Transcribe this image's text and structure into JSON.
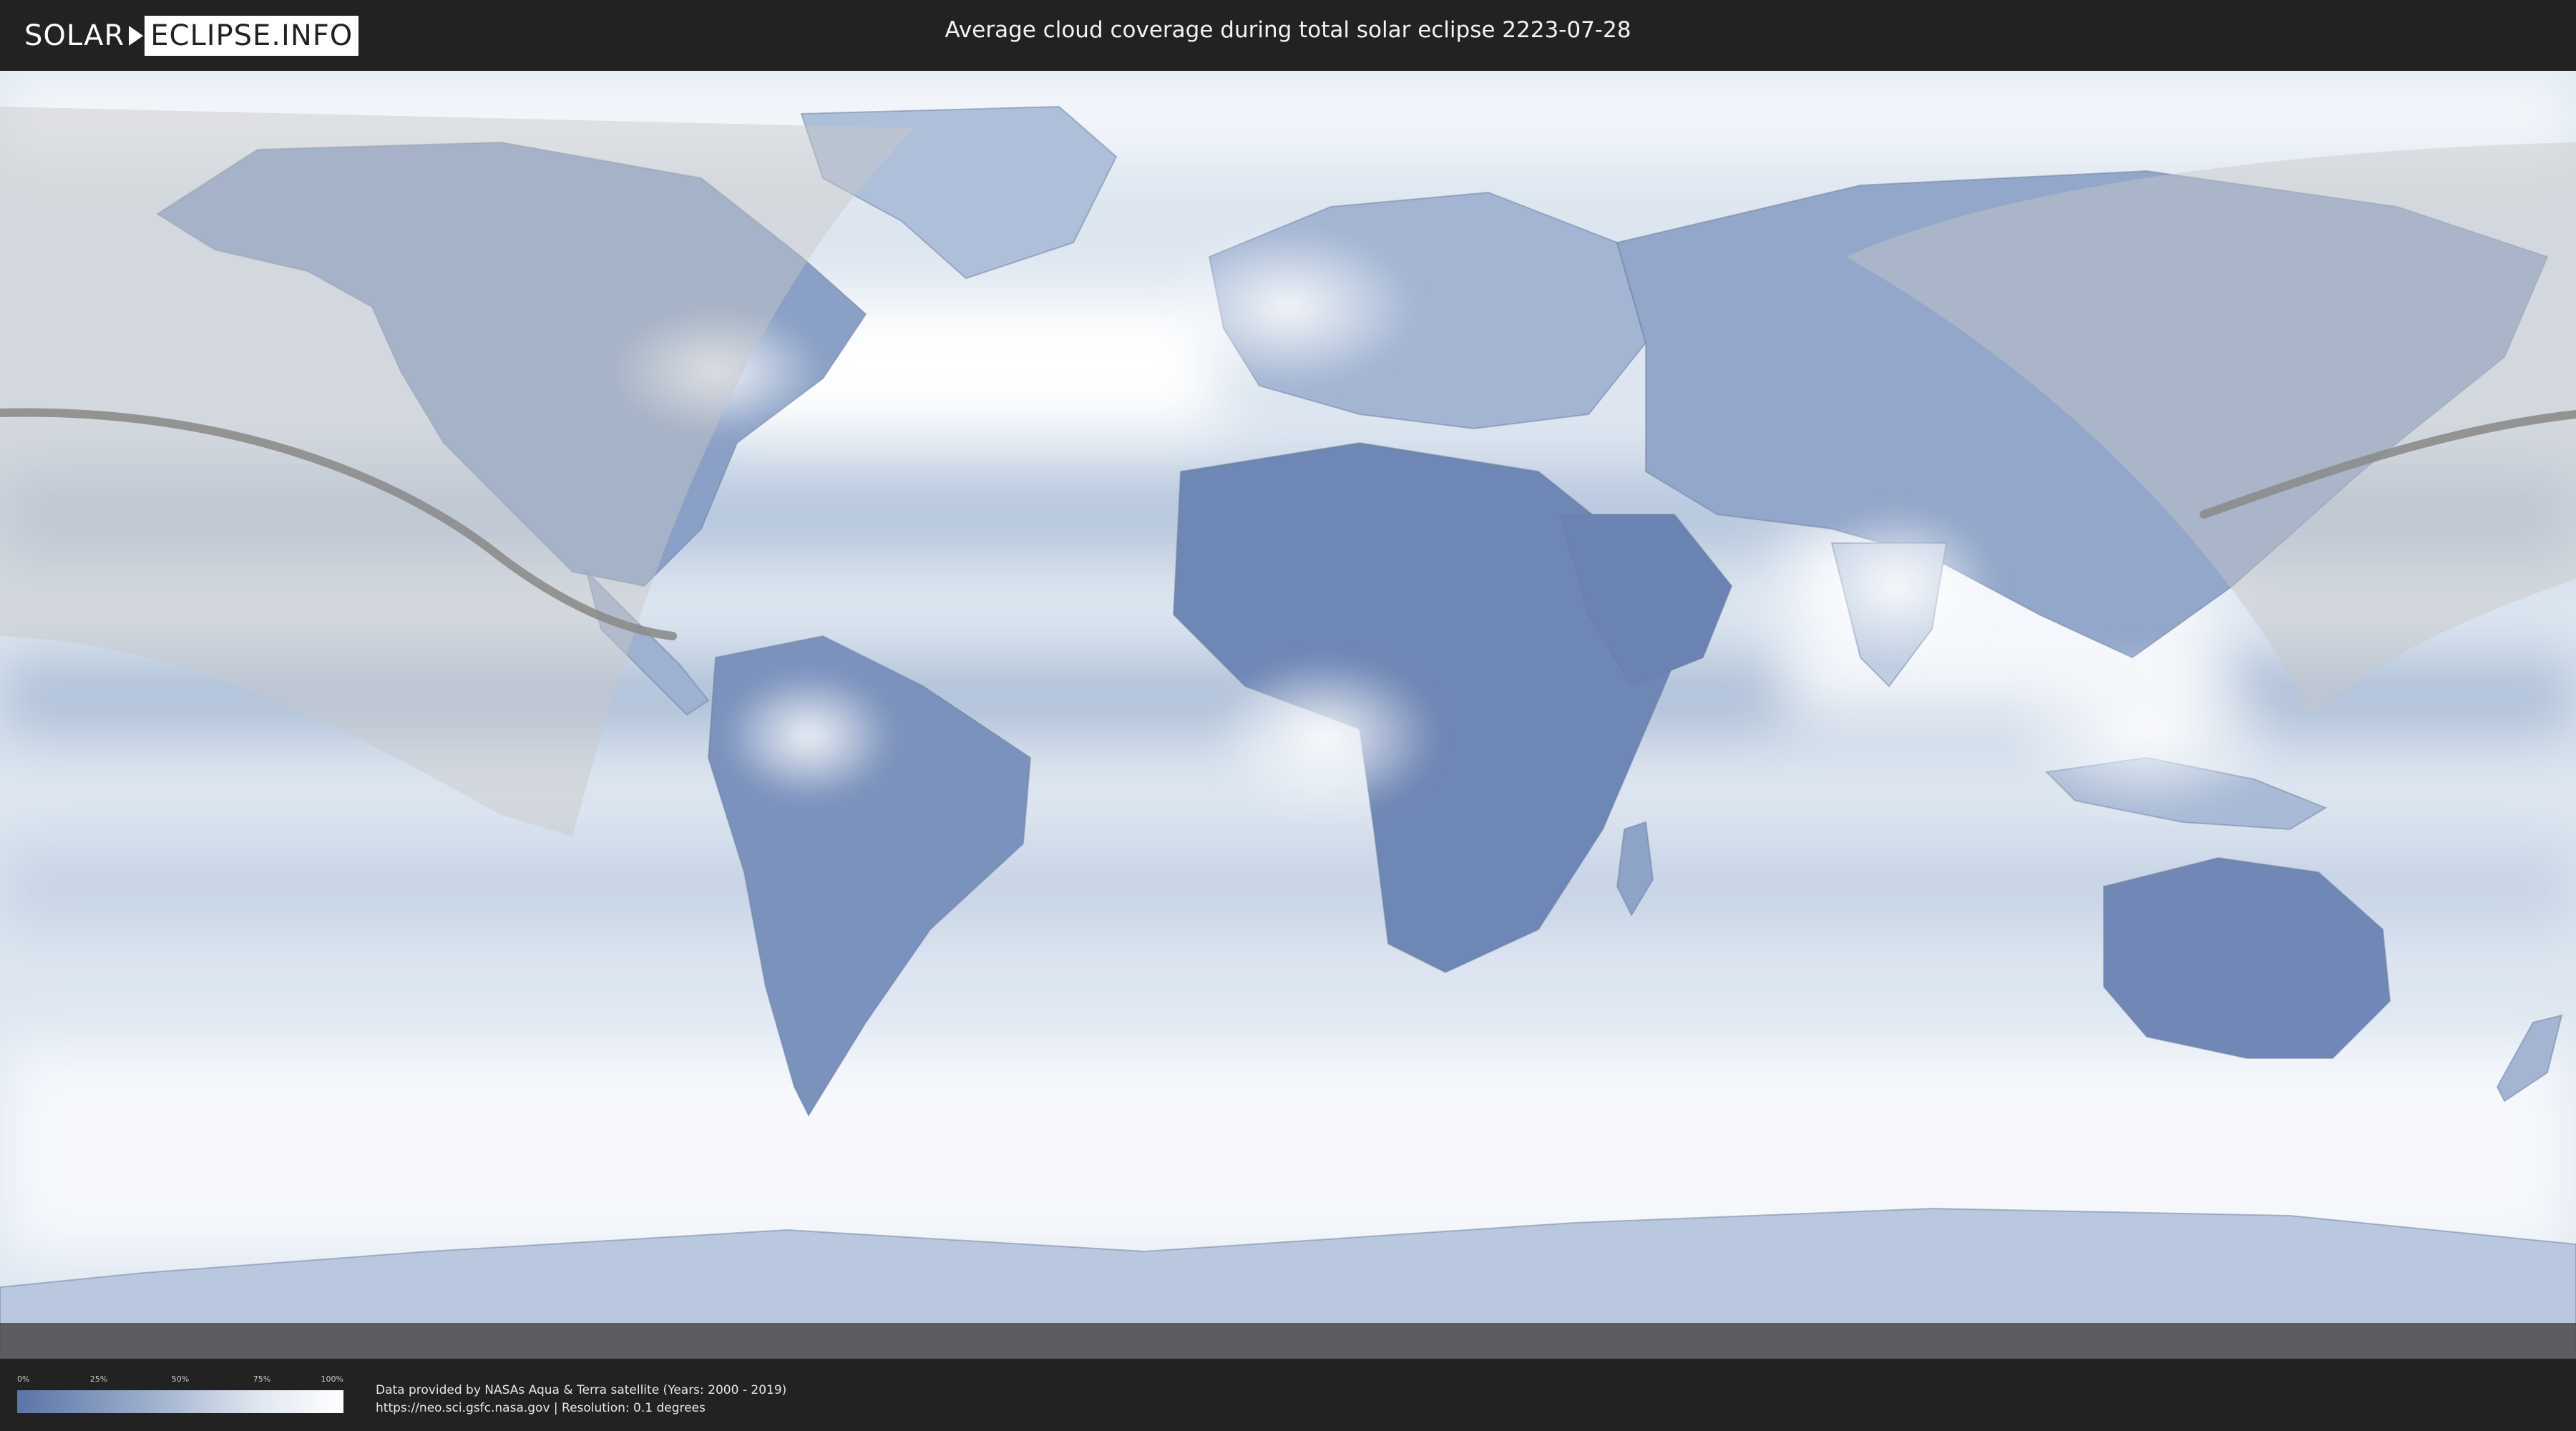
{
  "header": {
    "logo_left": "SOLAR",
    "logo_right": "ECLIPSE.INFO",
    "title": "Average cloud coverage during total solar eclipse 2223-07-28"
  },
  "legend": {
    "ticks": [
      "0%",
      "25%",
      "50%",
      "75%",
      "100%"
    ]
  },
  "footer": {
    "credit_line1": "Data provided by NASAs Aqua & Terra satellite (Years: 2000 - 2019)",
    "credit_line2": "https://neo.sci.gsfc.nasa.gov | Resolution: 0.1 degrees"
  },
  "map": {
    "palette": {
      "clear": "#5b74a6",
      "mid": "#b9c8de",
      "cloudy": "#ffffff",
      "ocean": "#dfe7f1"
    },
    "path_color": "#8c8c8c",
    "shade_color": "#c8c8c8"
  }
}
